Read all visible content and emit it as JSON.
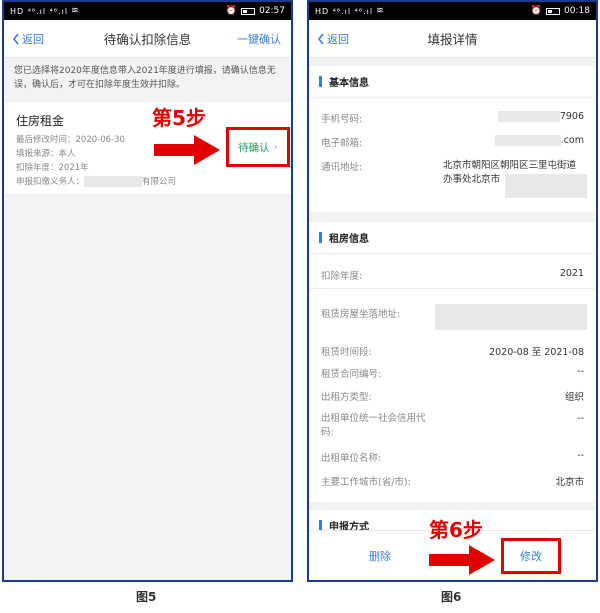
{
  "left": {
    "status": {
      "signal": "HD ⁴⁶.ıl ⁴⁶.ıl",
      "time": "02:57"
    },
    "nav": {
      "back": "返回",
      "title": "待确认扣除信息",
      "action": "一键确认"
    },
    "notice": "您已选择将2020年度信息带入2021年度进行填报，请确认信息无误，确认后，才可在扣除年度生效并扣除。",
    "card": {
      "title": "住房租金",
      "last_modified": "最后修改时间：2020-06-30",
      "source": "填报来源：本人",
      "year": "扣除年度：2021年",
      "agent_prefix": "申报扣缴义务人：",
      "agent_suffix": "有限公司",
      "status": "待确认"
    },
    "step": "第5步",
    "caption": "图5"
  },
  "right": {
    "status": {
      "signal": "HD ⁴⁶.ıl ⁴⁶.ıl",
      "time": "00:18"
    },
    "nav": {
      "back": "返回",
      "title": "填报详情"
    },
    "basic": {
      "heading": "基本信息",
      "phone_label": "手机号码:",
      "phone_tail": "7906",
      "email_label": "电子邮箱:",
      "email_tail": ".com",
      "address_label": "通讯地址:",
      "address_line1": "北京市朝阳区朝阳区三里屯街道",
      "address_line2": "办事处北京市"
    },
    "rent": {
      "heading": "租房信息",
      "year_label": "扣除年度:",
      "year_value": "2021",
      "location_label": "租赁房屋坐落地址:",
      "period_label": "租赁时间段:",
      "period_value": "2020-08 至 2021-08",
      "contract_label": "租赁合同编号:",
      "contract_value": "--",
      "lessor_type_label": "出租方类型:",
      "lessor_type_value": "组织",
      "credit_label_1": "出租单位统一社会信用代",
      "credit_label_2": "码:",
      "credit_value": "--",
      "lessor_name_label": "出租单位名称:",
      "lessor_name_value": "--",
      "city_label": "主要工作城市(省/市):",
      "city_value": "北京市"
    },
    "declare": {
      "heading": "申报方式"
    },
    "buttons": {
      "delete": "删除",
      "edit": "修改"
    },
    "step": "第6步",
    "caption": "图6"
  },
  "colors": {
    "accent_blue": "#3a7be0",
    "highlight_red": "#e00000",
    "pending_green": "#22a05a",
    "border_navy": "#1a3c8c"
  }
}
